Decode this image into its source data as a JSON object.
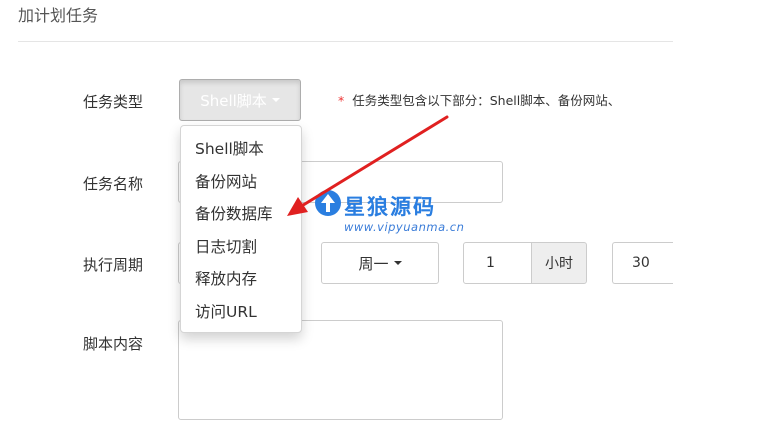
{
  "page": {
    "title": "加计划任务"
  },
  "form": {
    "task_type": {
      "label": "任务类型",
      "selected": "Shell脚本",
      "hint_star": "*",
      "hint": "任务类型包含以下部分：Shell脚本、备份网站、",
      "options": [
        "Shell脚本",
        "备份网站",
        "备份数据库",
        "日志切割",
        "释放内存",
        "访问URL"
      ]
    },
    "task_name": {
      "label": "任务名称",
      "value": ""
    },
    "period": {
      "label": "执行周期",
      "weekday": "周一",
      "hour_value": "1",
      "hour_unit": "小时",
      "minute_value": "30"
    },
    "script": {
      "label": "脚本内容",
      "value": ""
    }
  },
  "watermark": {
    "title": "星狼源码",
    "url": "www.vipyuanma.cn"
  },
  "colors": {
    "arrow": "#e02020",
    "watermark": "#2a7ee0",
    "active_button": "#e6e6e6"
  }
}
